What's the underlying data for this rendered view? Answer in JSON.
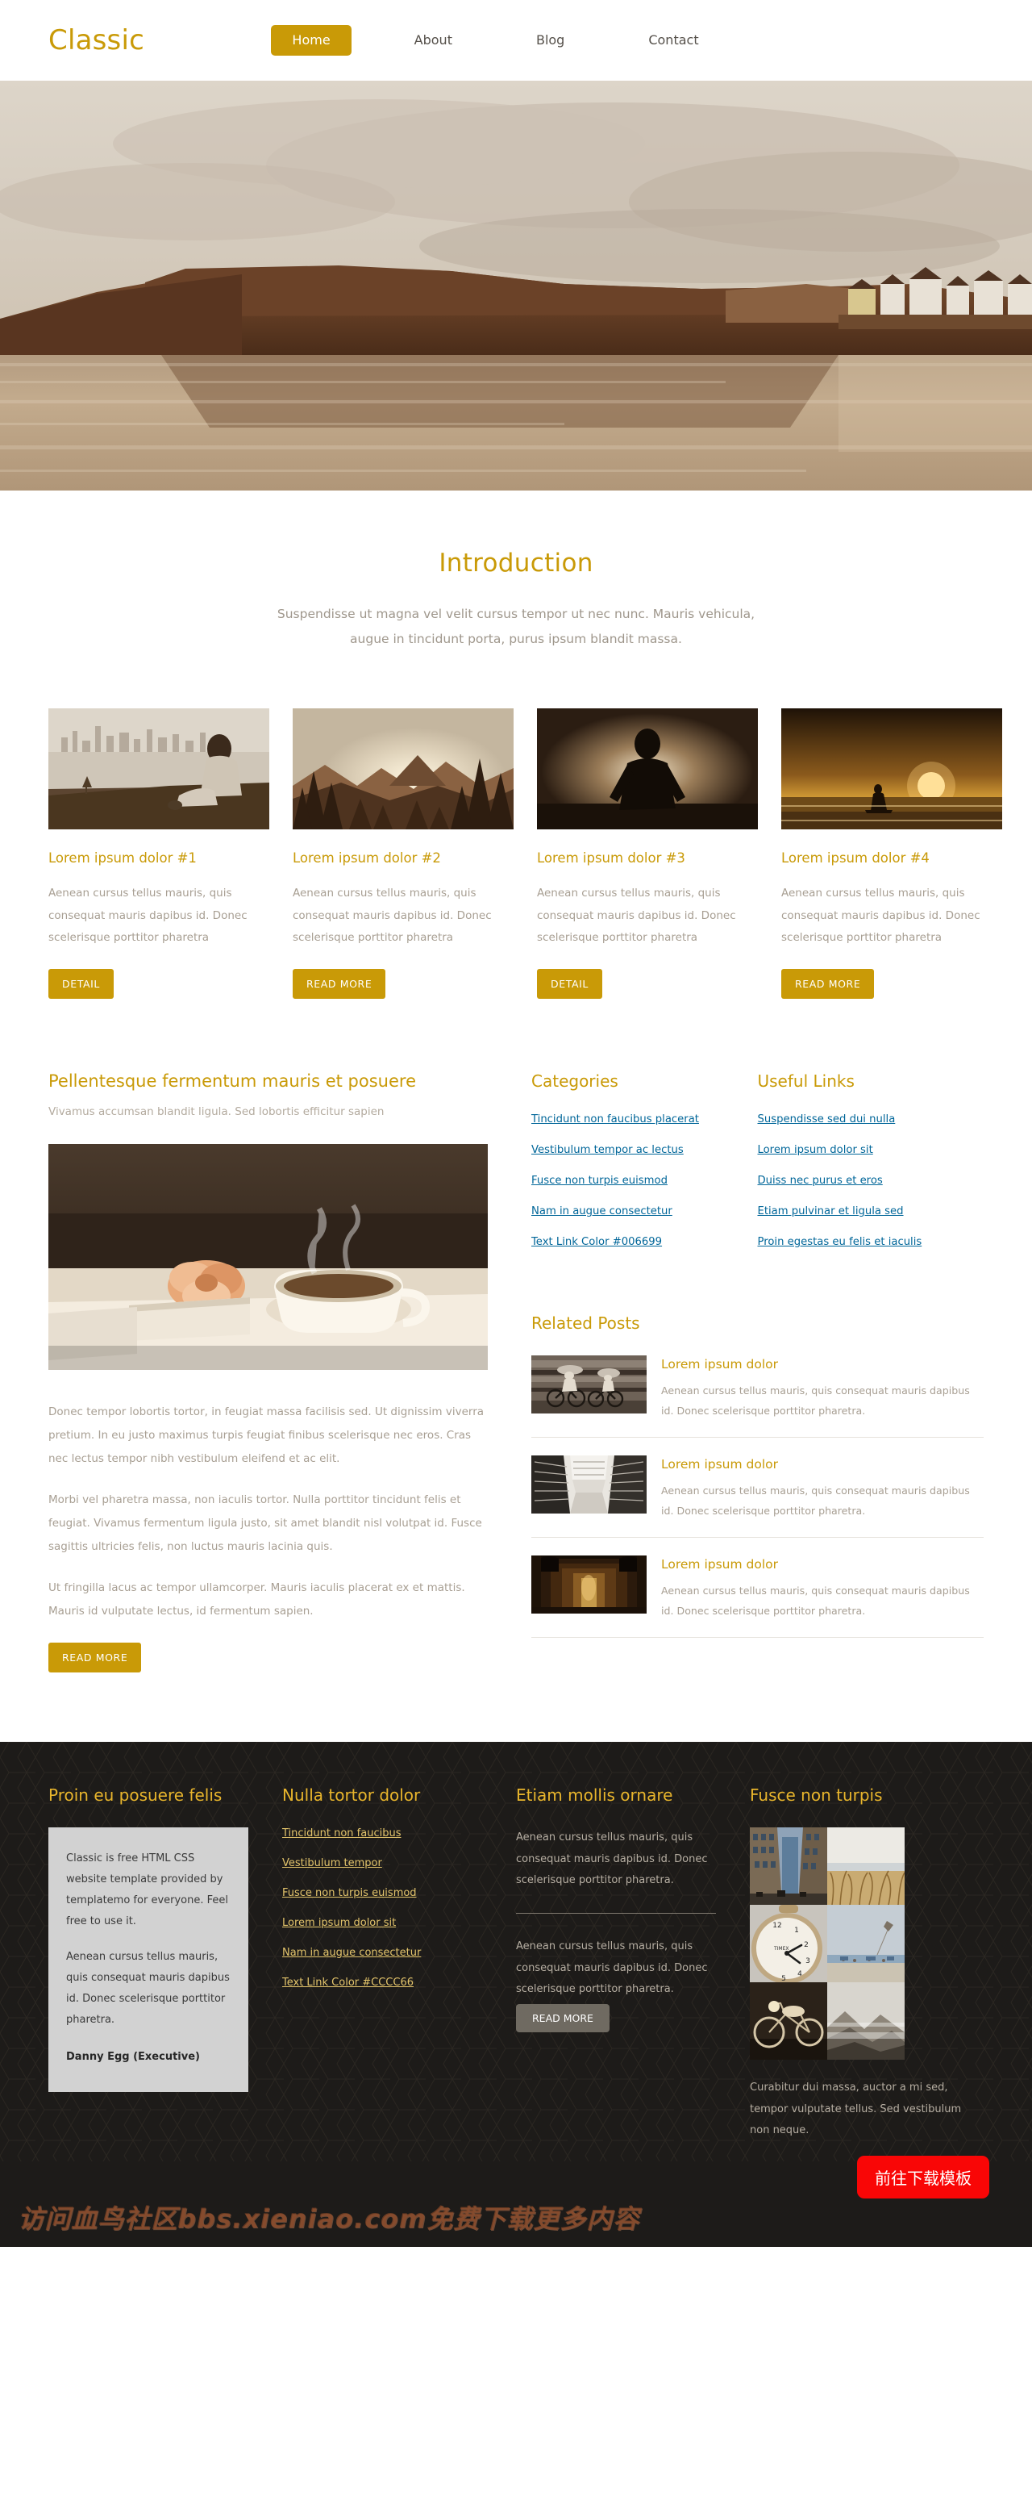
{
  "header": {
    "logo": "Classic",
    "nav": [
      {
        "label": "Home",
        "active": true
      },
      {
        "label": "About",
        "active": false
      },
      {
        "label": "Blog",
        "active": false
      },
      {
        "label": "Contact",
        "active": false
      }
    ]
  },
  "hero": {
    "alt": "coastal cliff town reflected in water, sepia tone"
  },
  "intro": {
    "title": "Introduction",
    "line1": "Suspendisse ut magna vel velit cursus tempor ut nec nunc. Mauris vehicula,",
    "line2": "augue in tincidunt porta, purus ipsum blandit massa."
  },
  "cards": [
    {
      "title": "Lorem ipsum dolor #1",
      "text": "Aenean cursus tellus mauris, quis consequat mauris dapibus id. Donec scelerisque porttitor pharetra",
      "button": "DETAIL",
      "image": "person-sitting-city-skyline"
    },
    {
      "title": "Lorem ipsum dolor #2",
      "text": "Aenean cursus tellus mauris, quis consequat mauris dapibus id. Donec scelerisque porttitor pharetra",
      "button": "READ MORE",
      "image": "mountain-valley-sunset"
    },
    {
      "title": "Lorem ipsum dolor #3",
      "text": "Aenean cursus tellus mauris, quis consequat mauris dapibus id. Donec scelerisque porttitor pharetra",
      "button": "DETAIL",
      "image": "silhouette-person-sunrise"
    },
    {
      "title": "Lorem ipsum dolor #4",
      "text": "Aenean cursus tellus mauris, quis consequat mauris dapibus id. Donec scelerisque porttitor pharetra",
      "button": "READ MORE",
      "image": "surfer-beach-sunset"
    }
  ],
  "article": {
    "title": "Pellentesque fermentum mauris et posuere",
    "subtitle": "Vivamus accumsan blandit ligula. Sed lobortis efficitur sapien",
    "image": "coffee-cup-book-flower",
    "p1": "Donec tempor lobortis tortor, in feugiat massa facilisis sed. Ut dignissim viverra pretium. In eu justo maximus turpis feugiat finibus scelerisque nec eros. Cras nec lectus tempor nibh vestibulum eleifend et ac elit.",
    "p2": "Morbi vel pharetra massa, non iaculis tortor. Nulla porttitor tincidunt felis et feugiat. Vivamus fermentum ligula justo, sit amet blandit nisl volutpat id. Fusce sagittis ultricies felis, non luctus mauris lacinia quis.",
    "p3": "Ut fringilla lacus ac tempor ullamcorper. Mauris iaculis placerat ex et mattis. Mauris id vulputate lectus, id fermentum sapien.",
    "button": "READ MORE"
  },
  "sidebar": {
    "categories_title": "Categories",
    "categories": [
      "Tincidunt non faucibus placerat",
      "Vestibulum tempor ac lectus",
      "Fusce non turpis euismod",
      "Nam in augue consectetur",
      "Text Link Color #006699"
    ],
    "useful_title": "Useful Links",
    "useful": [
      "Suspendisse sed dui nulla",
      "Lorem ipsum dolor sit",
      "Duiss nec purus et eros",
      "Etiam pulvinar et ligula sed",
      "Proin egestas eu felis et iaculis"
    ],
    "related_title": "Related Posts",
    "related": [
      {
        "title": "Lorem ipsum dolor",
        "text": "Aenean cursus tellus mauris, quis consequat mauris dapibus id. Donec scelerisque porttitor pharetra.",
        "image": "cyclists-motion-blur"
      },
      {
        "title": "Lorem ipsum dolor",
        "text": "Aenean cursus tellus mauris, quis consequat mauris dapibus id. Donec scelerisque porttitor pharetra.",
        "image": "modern-architecture-perspective"
      },
      {
        "title": "Lorem ipsum dolor",
        "text": "Aenean cursus tellus mauris, quis consequat mauris dapibus id. Donec scelerisque porttitor pharetra.",
        "image": "dark-corridor-arches"
      }
    ]
  },
  "footer": {
    "col1": {
      "title": "Proin eu posuere felis",
      "quote_p1": "Classic is free HTML CSS website template provided by templatemo for everyone. Feel free to use it.",
      "quote_p2": "Aenean cursus tellus mauris, quis consequat mauris dapibus id. Donec scelerisque porttitor pharetra.",
      "author": "Danny Egg (Executive)"
    },
    "col2": {
      "title": "Nulla tortor dolor",
      "links": [
        "Tincidunt non faucibus",
        "Vestibulum tempor",
        "Fusce non turpis euismod",
        "Lorem ipsum dolor sit",
        "Nam in augue consectetur",
        "Text Link Color #CCCC66"
      ]
    },
    "col3": {
      "title": "Etiam mollis ornare",
      "p1": "Aenean cursus tellus mauris, quis consequat mauris dapibus id. Donec scelerisque porttitor pharetra.",
      "p2": "Aenean cursus tellus mauris, quis consequat mauris dapibus id. Donec scelerisque porttitor pharetra.",
      "button": "READ MORE"
    },
    "col4": {
      "title": "Fusce non turpis",
      "gallery": [
        "city-street-buildings",
        "beach-dune-grass",
        "timex-clock-closeup",
        "beach-kite-flyers",
        "vintage-motorcycle",
        "misty-mountain-ridge"
      ],
      "text": "Curabitur dui massa, auctor a mi sed, tempor vulputate tellus. Sed vestibulum non neque."
    }
  },
  "overlay": {
    "watermark": "访问血鸟社区bbs.xieniao.com免费下载更多内容",
    "download_button": "前往下载模板"
  },
  "colors": {
    "accent": "#c99a07",
    "link": "#006699",
    "footer_bg": "#1d1b19",
    "footer_heading": "#e8b52c",
    "footer_link": "#e3c46b",
    "download_red": "#f90606"
  }
}
